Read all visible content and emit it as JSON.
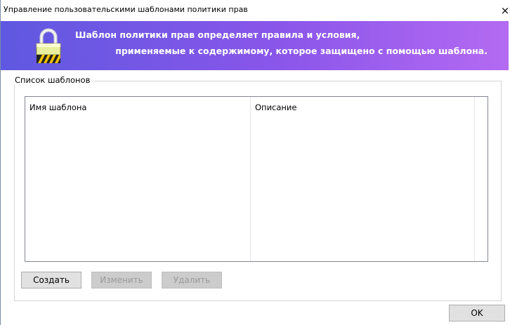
{
  "window": {
    "title": "Управление пользовательскими шаблонами политики прав",
    "close_glyph": "✕"
  },
  "banner": {
    "line1": "Шаблон политики прав определяет правила и условия,",
    "line2": "применяемые к содержимому, которое защищено с помощью шаблона.",
    "icon": "padlock-icon"
  },
  "templates_group": {
    "label": "Список шаблонов",
    "columns": [
      "Имя шаблона",
      "Описание"
    ],
    "rows": []
  },
  "buttons": {
    "create": "Создать",
    "edit": "Изменить",
    "delete": "Удалить",
    "ok": "OK"
  },
  "colors": {
    "banner_start": "#5f58e0",
    "banner_end": "#b46af2"
  }
}
